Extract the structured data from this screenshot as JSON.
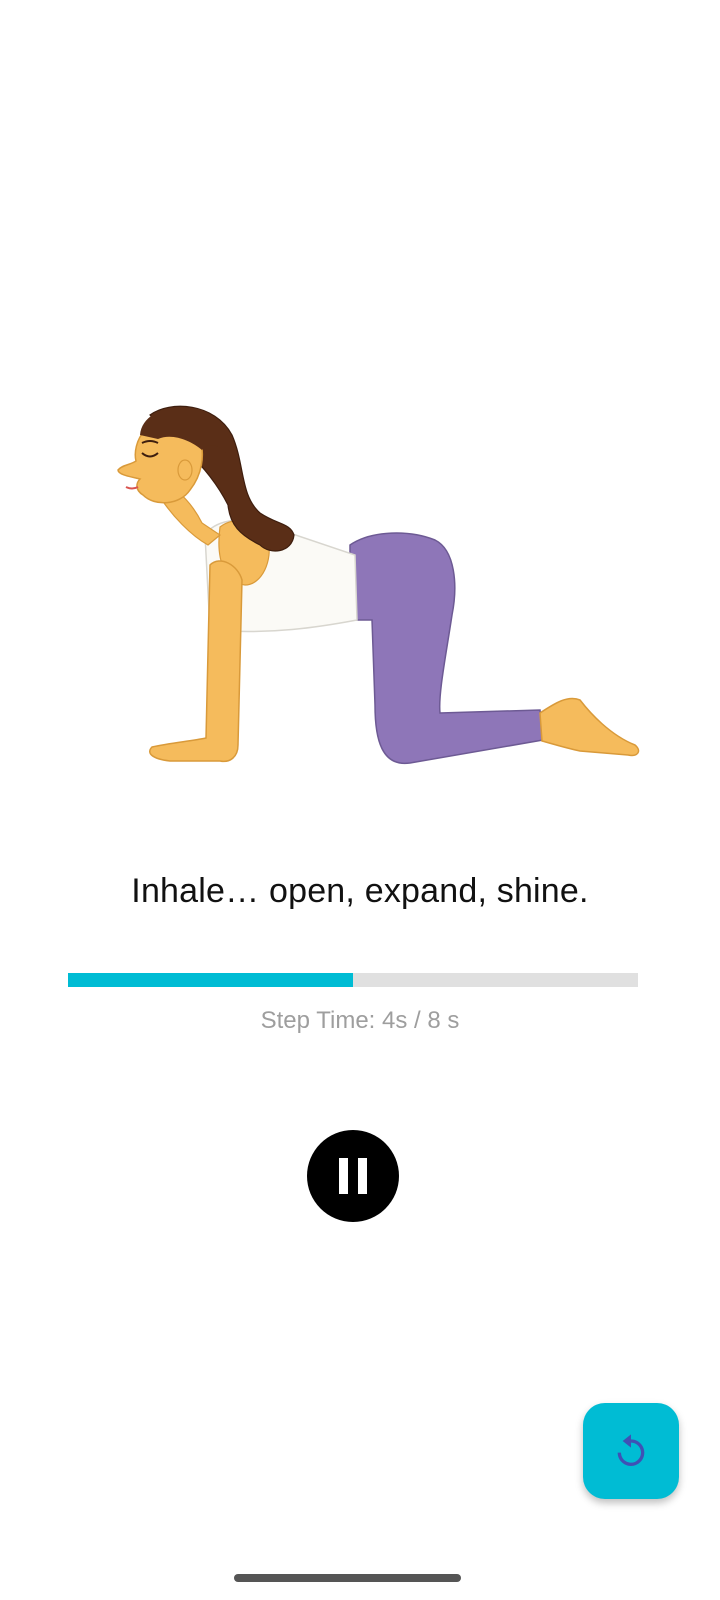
{
  "illustration": {
    "subject_icon": "yoga-cow-pose-illustration",
    "colors": {
      "skin": "#f5bb5c",
      "hair": "#5a2e17",
      "top": "#fbfaf6",
      "leggings": "#8e76b8"
    }
  },
  "instruction": {
    "text": "Inhale… open, expand, shine."
  },
  "progress": {
    "fraction": 0.5,
    "fill_color": "#00bcd4",
    "track_color": "#e0e0e0"
  },
  "step_time": {
    "text": "Step Time: 4s / 8 s"
  },
  "controls": {
    "pause_icon": "pause-icon",
    "reset_icon": "restart-icon",
    "fab_color": "#00bcd4",
    "reset_icon_color": "#3f51b5"
  }
}
